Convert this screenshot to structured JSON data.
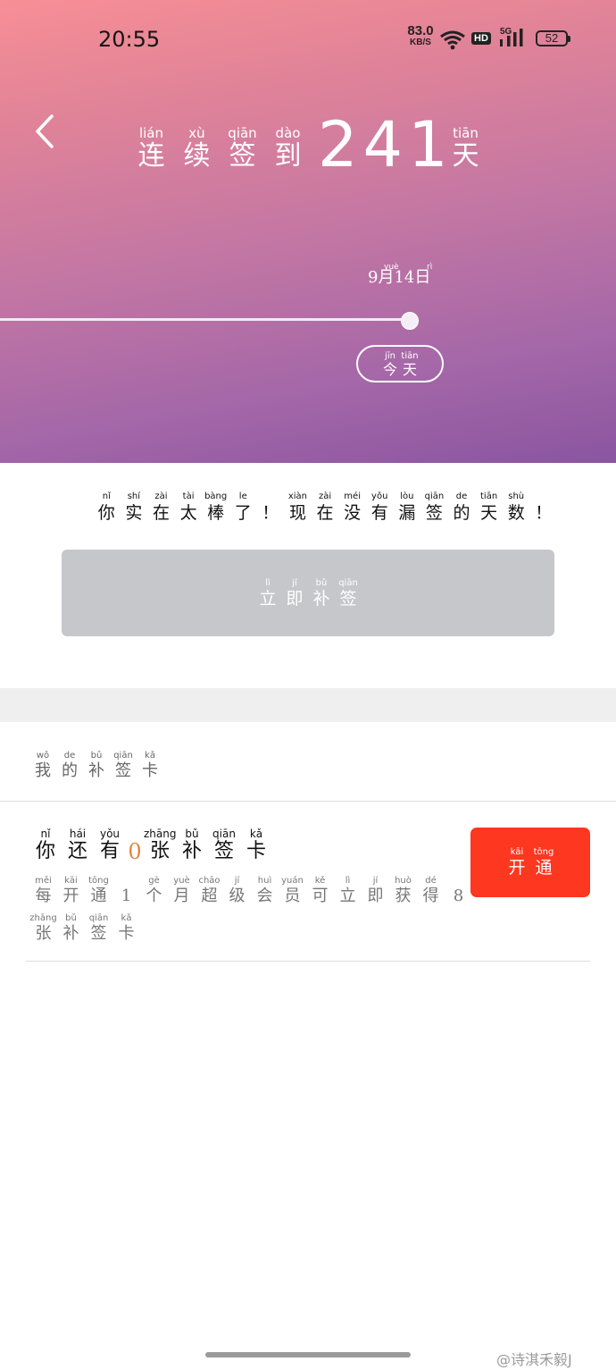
{
  "status": {
    "time": "20:55",
    "net_speed_value": "83.0",
    "net_speed_unit": "KB/S",
    "hd": "HD",
    "network": "5G",
    "battery": "52",
    "icons": [
      "wifi-icon",
      "signal-icon",
      "battery-icon"
    ]
  },
  "header": {
    "back_icon": "chevron-left-icon",
    "prefix": [
      {
        "p": "lián",
        "c": "连"
      },
      {
        "p": "xù",
        "c": "续"
      },
      {
        "p": "qiān",
        "c": "签"
      },
      {
        "p": "dào",
        "c": "到"
      }
    ],
    "count": "241",
    "suffix": {
      "p": "tiān",
      "c": "天"
    }
  },
  "timeline": {
    "date_text": "9月14日",
    "date_pinyin_month": "yuè",
    "date_pinyin_day": "rì",
    "progress": 1.0,
    "today_button": [
      {
        "p": "jīn",
        "c": "今"
      },
      {
        "p": "tiān",
        "c": "天"
      }
    ]
  },
  "message": [
    {
      "p": "nǐ",
      "c": "你"
    },
    {
      "p": "shí",
      "c": "实"
    },
    {
      "p": "zài",
      "c": "在"
    },
    {
      "p": "tài",
      "c": "太"
    },
    {
      "p": "bàng",
      "c": "棒"
    },
    {
      "p": "le",
      "c": "了"
    },
    {
      "p": "",
      "c": "！"
    },
    {
      "p": "xiàn",
      "c": "现"
    },
    {
      "p": "zài",
      "c": "在"
    },
    {
      "p": "méi",
      "c": "没"
    },
    {
      "p": "yǒu",
      "c": "有"
    },
    {
      "p": "lòu",
      "c": "漏"
    },
    {
      "p": "qiān",
      "c": "签"
    },
    {
      "p": "de",
      "c": "的"
    },
    {
      "p": "tiān",
      "c": "天"
    },
    {
      "p": "shù",
      "c": "数"
    },
    {
      "p": "",
      "c": "！"
    }
  ],
  "supplement_button": [
    {
      "p": "lì",
      "c": "立"
    },
    {
      "p": "jí",
      "c": "即"
    },
    {
      "p": "bǔ",
      "c": "补"
    },
    {
      "p": "qiān",
      "c": "签"
    }
  ],
  "my_cards_title": [
    {
      "p": "wǒ",
      "c": "我"
    },
    {
      "p": "de",
      "c": "的"
    },
    {
      "p": "bǔ",
      "c": "补"
    },
    {
      "p": "qiān",
      "c": "签"
    },
    {
      "p": "kǎ",
      "c": "卡"
    }
  ],
  "cards_have": {
    "before": [
      {
        "p": "nǐ",
        "c": "你"
      },
      {
        "p": "hái",
        "c": "还"
      },
      {
        "p": "yǒu",
        "c": "有"
      }
    ],
    "count": "0",
    "after": [
      {
        "p": "zhāng",
        "c": "张"
      },
      {
        "p": "bǔ",
        "c": "补"
      },
      {
        "p": "qiān",
        "c": "签"
      },
      {
        "p": "kǎ",
        "c": "卡"
      }
    ]
  },
  "cards_desc": {
    "line1": [
      {
        "p": "měi",
        "c": "每"
      },
      {
        "p": "kāi",
        "c": "开"
      },
      {
        "p": "tōng",
        "c": "通"
      },
      {
        "p": "",
        "c": "1"
      },
      {
        "p": "gè",
        "c": "个"
      },
      {
        "p": "yuè",
        "c": "月"
      },
      {
        "p": "chāo",
        "c": "超"
      },
      {
        "p": "jí",
        "c": "级"
      },
      {
        "p": "huì",
        "c": "会"
      },
      {
        "p": "yuán",
        "c": "员"
      },
      {
        "p": "kě",
        "c": "可"
      },
      {
        "p": "lì",
        "c": "立"
      },
      {
        "p": "jí",
        "c": "即"
      },
      {
        "p": "huò",
        "c": "获"
      },
      {
        "p": "dé",
        "c": "得"
      },
      {
        "p": "",
        "c": "8"
      }
    ],
    "line2": [
      {
        "p": "zhāng",
        "c": "张"
      },
      {
        "p": "bǔ",
        "c": "补"
      },
      {
        "p": "qiān",
        "c": "签"
      },
      {
        "p": "kǎ",
        "c": "卡"
      }
    ]
  },
  "open_button": [
    {
      "p": "kāi",
      "c": "开"
    },
    {
      "p": "tōng",
      "c": "通"
    }
  ],
  "watermark": "@诗淇禾毅J",
  "colors": {
    "accent_red": "#fe3720",
    "disabled_gray": "#c6c7cb",
    "highlight_orange": "#e8843b"
  }
}
